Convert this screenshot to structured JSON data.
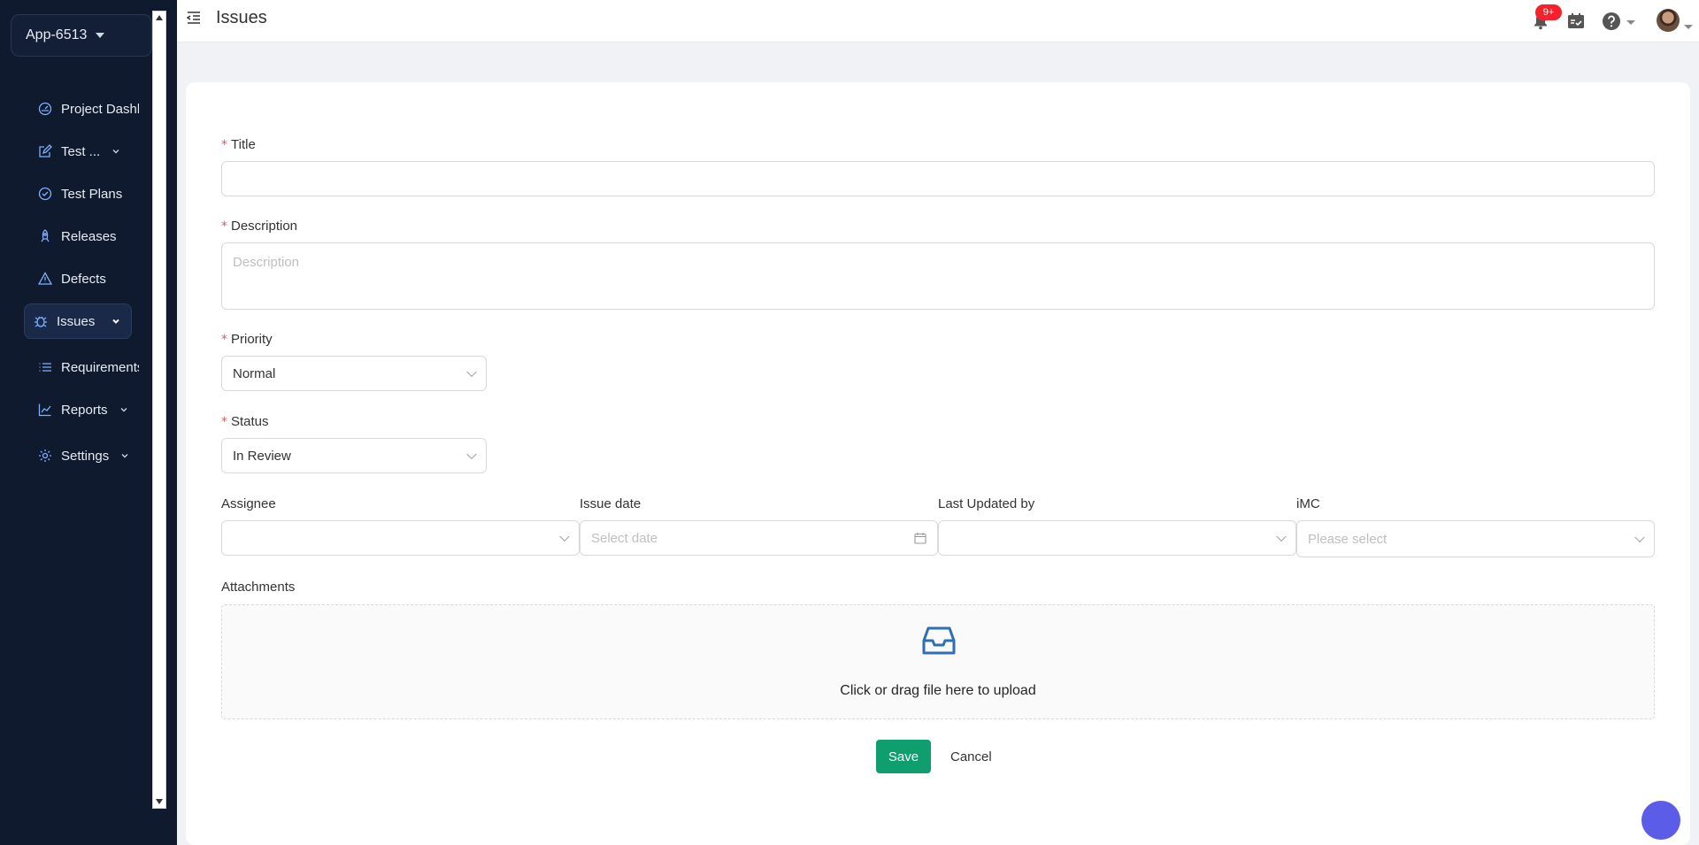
{
  "app_switcher": {
    "label": "App-6513"
  },
  "sidebar": {
    "items": [
      {
        "label": "Project Dashb",
        "icon": "dashboard-icon",
        "has_chevron": false,
        "active": false
      },
      {
        "label": "Test ...",
        "icon": "edit-icon",
        "has_chevron": true,
        "active": false
      },
      {
        "label": "Test Plans",
        "icon": "check-circle-icon",
        "has_chevron": false,
        "active": false
      },
      {
        "label": "Releases",
        "icon": "rocket-icon",
        "has_chevron": false,
        "active": false
      },
      {
        "label": "Defects",
        "icon": "warning-icon",
        "has_chevron": false,
        "active": false
      },
      {
        "label": "Issues",
        "icon": "bug-icon",
        "has_chevron": true,
        "active": true
      },
      {
        "label": "Requirements",
        "icon": "list-icon",
        "has_chevron": false,
        "active": false
      },
      {
        "label": "Reports",
        "icon": "line-chart-icon",
        "has_chevron": true,
        "active": false
      },
      {
        "label": "Settings",
        "icon": "gear-icon",
        "has_chevron": true,
        "active": false
      }
    ]
  },
  "header": {
    "title": "Issues",
    "notification_badge": "9+"
  },
  "form": {
    "title": {
      "label": "Title",
      "value": ""
    },
    "description": {
      "label": "Description",
      "placeholder": "Description"
    },
    "priority": {
      "label": "Priority",
      "value": "Normal"
    },
    "status": {
      "label": "Status",
      "value": "In Review"
    },
    "assignee": {
      "label": "Assignee",
      "value": ""
    },
    "issue_date": {
      "label": "Issue date",
      "placeholder": "Select date"
    },
    "last_updated_by": {
      "label": "Last Updated by",
      "value": ""
    },
    "imc": {
      "label": "iMC",
      "placeholder": "Please select"
    },
    "attachments": {
      "label": "Attachments",
      "upload_text": "Click or drag file here to upload"
    }
  },
  "actions": {
    "save_label": "Save",
    "cancel_label": "Cancel"
  },
  "colors": {
    "sidebar_bg": "#0f1a2e",
    "primary_save": "#0f9f6e",
    "required_mark": "#ff4d4f",
    "badge": "#f5222d"
  }
}
